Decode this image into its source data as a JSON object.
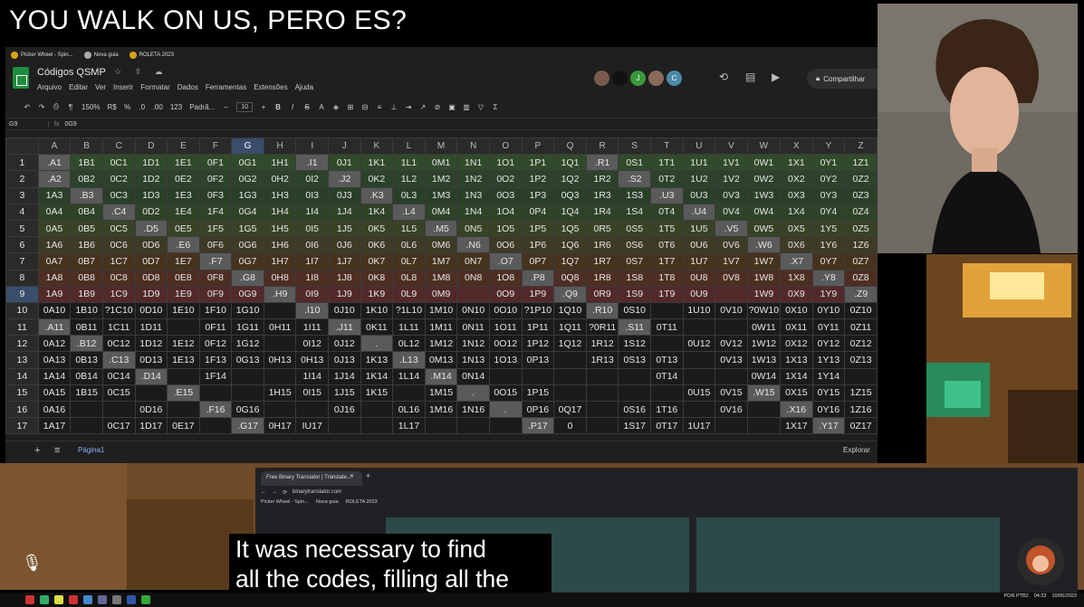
{
  "headline": "YOU WALK ON US, PERO ES?",
  "bookmarks": [
    "Picker Wheel - Spin...",
    "Nova guia",
    "ROLETA 2023"
  ],
  "doc": {
    "title": "Códigos QSMP",
    "menu": [
      "Arquivo",
      "Editar",
      "Ver",
      "Inserir",
      "Formatar",
      "Dados",
      "Ferramentas",
      "Extensões",
      "Ajuda"
    ],
    "share_label": "Compartilhar",
    "avatars": [
      {
        "letter": "",
        "color": "#7a5a4a"
      },
      {
        "letter": "",
        "color": "#111111"
      },
      {
        "letter": "J",
        "color": "#3a9a3a"
      },
      {
        "letter": "",
        "color": "#8a6a5a"
      },
      {
        "letter": "C",
        "color": "#4a8aa8"
      }
    ]
  },
  "toolbar": {
    "zoom": "150%",
    "currency": "R$",
    "percent": "%",
    "dec1": ".0",
    "dec2": ".00",
    "fmt123": "123",
    "font": "Padrã...",
    "font_size": "10"
  },
  "formula_bar": {
    "cell": "G9",
    "fx": "fx",
    "value": "0G9"
  },
  "grid": {
    "columns": [
      "A",
      "B",
      "C",
      "D",
      "E",
      "F",
      "G",
      "H",
      "I",
      "J",
      "K",
      "L",
      "M",
      "N",
      "O",
      "P",
      "Q",
      "R",
      "S",
      "T",
      "U",
      "V",
      "W",
      "X",
      "Y",
      "Z"
    ],
    "selected_col": "G",
    "selected_row": "9",
    "rows": [
      {
        "n": "1",
        "cells": [
          ".A1",
          "1B1",
          "0C1",
          "1D1",
          "1E1",
          "0F1",
          "0G1",
          "1H1",
          ".I1",
          "0J1",
          "1K1",
          "1L1",
          "0M1",
          "1N1",
          "1O1",
          "1P1",
          "1Q1",
          ".R1",
          "0S1",
          "1T1",
          "1U1",
          "1V1",
          "0W1",
          "1X1",
          "0Y1",
          "1Z1"
        ]
      },
      {
        "n": "2",
        "cells": [
          ".A2",
          "0B2",
          "0C2",
          "1D2",
          "0E2",
          "0F2",
          "0G2",
          "0H2",
          "0I2",
          ".J2",
          "0K2",
          "1L2",
          "1M2",
          "1N2",
          "0O2",
          "1P2",
          "1Q2",
          "1R2",
          ".S2",
          "0T2",
          "1U2",
          "1V2",
          "0W2",
          "0X2",
          "0Y2",
          "0Z2"
        ]
      },
      {
        "n": "3",
        "cells": [
          "1A3",
          ".B3",
          "0C3",
          "1D3",
          "1E3",
          "0F3",
          "1G3",
          "1H3",
          "0I3",
          "0J3",
          ".K3",
          "0L3",
          "1M3",
          "1N3",
          "0O3",
          "1P3",
          "0Q3",
          "1R3",
          "1S3",
          ".U3",
          "0U3",
          "0V3",
          "1W3",
          "0X3",
          "0Y3",
          "0Z3"
        ]
      },
      {
        "n": "4",
        "cells": [
          "0A4",
          "0B4",
          ".C4",
          "0D2",
          "1E4",
          "1F4",
          "0G4",
          "1H4",
          "1I4",
          "1J4",
          "1K4",
          ".L4",
          "0M4",
          "1N4",
          "1O4",
          "0P4",
          "1Q4",
          "1R4",
          "1S4",
          "0T4",
          ".U4",
          "0V4",
          "0W4",
          "1X4",
          "0Y4",
          "0Z4"
        ]
      },
      {
        "n": "5",
        "cells": [
          "0A5",
          "0B5",
          "0C5",
          ".D5",
          "0E5",
          "1F5",
          "1G5",
          "1H5",
          "0I5",
          "1J5",
          "0K5",
          "1L5",
          ".M5",
          "0N5",
          "1O5",
          "1P5",
          "1Q5",
          "0R5",
          "0S5",
          "1T5",
          "1U5",
          ".V5",
          "0W5",
          "0X5",
          "1Y5",
          "0Z5"
        ]
      },
      {
        "n": "6",
        "cells": [
          "1A6",
          "1B6",
          "0C6",
          "0D6",
          ".E6",
          "0F6",
          "0G6",
          "1H6",
          "0I6",
          "0J6",
          "0K6",
          "0L6",
          "0M6",
          ".N6",
          "0O6",
          "1P6",
          "1Q6",
          "1R6",
          "0S6",
          "0T6",
          "0U6",
          "0V6",
          ".W6",
          "0X6",
          "1Y6",
          "1Z6"
        ]
      },
      {
        "n": "7",
        "cells": [
          "0A7",
          "0B7",
          "1C7",
          "0D7",
          "1E7",
          ".F7",
          "0G7",
          "1H7",
          "1I7",
          "1J7",
          "0K7",
          "0L7",
          "1M7",
          "0N7",
          ".O7",
          "0P7",
          "1Q7",
          "1R7",
          "0S7",
          "1T7",
          "1U7",
          "1V7",
          "1W7",
          ".X7",
          "0Y7",
          "0Z7"
        ]
      },
      {
        "n": "8",
        "cells": [
          "1A8",
          "0B8",
          "0C8",
          "0D8",
          "0E8",
          "0F8",
          ".G8",
          "0H8",
          "1I8",
          "1J8",
          "0K8",
          "0L8",
          "1M8",
          "0N8",
          "1O8",
          ".P8",
          "0Q8",
          "1R8",
          "1S8",
          "1T8",
          "0U8",
          "0V8",
          "1W8",
          "1X8",
          ".Y8",
          "0Z8"
        ]
      },
      {
        "n": "9",
        "cells": [
          "1A9",
          "1B9",
          "1C9",
          "1D9",
          "1E9",
          "0F9",
          "0G9",
          ".H9",
          "0I9",
          "1J9",
          "1K9",
          "0L9",
          "0M9",
          "",
          "0O9",
          "1P9",
          ".Q9",
          "0R9",
          "1S9",
          "1T9",
          "0U9",
          "",
          "1W9",
          "0X9",
          "1Y9",
          ".Z9"
        ]
      },
      {
        "n": "10",
        "cells": [
          "0A10",
          "1B10",
          "?1C10",
          "0D10",
          "1E10",
          "1F10",
          "1G10",
          "",
          ".I10",
          "0J10",
          "1K10",
          "?1L10",
          "1M10",
          "0N10",
          "0O10",
          "?1P10",
          "1Q10",
          ".R10",
          "0S10",
          "",
          "1U10",
          "0V10",
          "?0W10",
          "0X10",
          "0Y10",
          "0Z10"
        ]
      },
      {
        "n": "11",
        "cells": [
          ".A11",
          "0B11",
          "1C11",
          "1D11",
          "",
          "0F11",
          "1G11",
          "0H11",
          "1I11",
          ".J11",
          "0K11",
          "1L11",
          "1M11",
          "0N11",
          "1O11",
          "1P11",
          "1Q11",
          "?0R11",
          ".S11",
          "0T11",
          "",
          "",
          "0W11",
          "0X11",
          "0Y11",
          "0Z11"
        ]
      },
      {
        "n": "12",
        "cells": [
          "0A12",
          ".B12",
          "0C12",
          "1D12",
          "1E12",
          "0F12",
          "1G12",
          "",
          "0I12",
          "0J12",
          ".",
          "0L12",
          "1M12",
          "1N12",
          "0O12",
          "1P12",
          "1Q12",
          "1R12",
          "1S12",
          "",
          "0U12",
          "0V12",
          "1W12",
          "0X12",
          "0Y12",
          "0Z12"
        ]
      },
      {
        "n": "13",
        "cells": [
          "0A13",
          "0B13",
          ".C13",
          "0D13",
          "1E13",
          "1F13",
          "0G13",
          "0H13",
          "0H13",
          "0J13",
          "1K13",
          ".L13",
          "0M13",
          "1N13",
          "1O13",
          "0P13",
          "",
          "1R13",
          "0S13",
          "0T13",
          "",
          "0V13",
          "1W13",
          "1X13",
          "1Y13",
          "0Z13"
        ]
      },
      {
        "n": "14",
        "cells": [
          "1A14",
          "0B14",
          "0C14",
          ".D14",
          "",
          "1F14",
          "",
          "",
          "1I14",
          "1J14",
          "1K14",
          "1L14",
          ".M14",
          "0N14",
          "",
          "",
          "",
          "",
          "",
          "0T14",
          "",
          "",
          "0W14",
          "1X14",
          "1Y14",
          ""
        ]
      },
      {
        "n": "15",
        "cells": [
          "0A15",
          "1B15",
          "0C15",
          "",
          ".E15",
          "",
          "",
          "1H15",
          "0I15",
          "1J15",
          "1K15",
          "",
          "1M15",
          ".",
          "0O15",
          "1P15",
          "",
          "",
          "",
          "",
          "0U15",
          "0V15",
          ".W15",
          "0X15",
          "0Y15",
          "1Z15"
        ]
      },
      {
        "n": "16",
        "cells": [
          "0A16",
          "",
          "",
          "0D16",
          "",
          ".F16",
          "0G16",
          "",
          "",
          "0J16",
          "",
          "0L16",
          "1M16",
          "1N16",
          ".",
          "0P16",
          "0Q17",
          "",
          "0S16",
          "1T16",
          "",
          "0V16",
          "",
          ".X16",
          "0Y16",
          "1Z16"
        ]
      },
      {
        "n": "17",
        "cells": [
          "1A17",
          "",
          "0C17",
          "1D17",
          "0E17",
          "",
          ".G17",
          "0H17",
          "IU17",
          "",
          "",
          "1L17",
          "",
          "",
          "",
          ".P17",
          "0",
          "",
          "1S17",
          "0T17",
          "1U17",
          "",
          "",
          "1X17",
          ".Y17",
          "0Z17"
        ]
      }
    ]
  },
  "sheet_tab": "Página1",
  "explore_label": "Explorar",
  "browser": {
    "tab_title": "Free Binary Translator | Translate...",
    "url": "binarytranslator.com",
    "bookmarks": [
      "Picker Wheel - Spin...",
      "Nova guia",
      "ROLETA 2023"
    ]
  },
  "subtitle": [
    "It was necessary to find",
    "all the codes, filling all the"
  ],
  "tray": {
    "lang": "POR PTB2",
    "time": "04:23",
    "date": "10/05/2023"
  }
}
